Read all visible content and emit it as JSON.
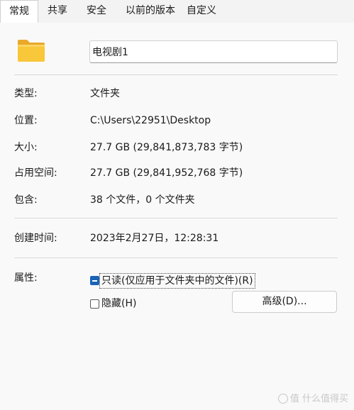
{
  "tabs": [
    {
      "label": "常规",
      "active": true
    },
    {
      "label": "共享",
      "active": false
    },
    {
      "label": "安全",
      "active": false
    },
    {
      "label": "以前的版本",
      "active": false
    },
    {
      "label": "自定义",
      "active": false
    }
  ],
  "folder_icon": "folder-icon",
  "name": "电视剧1",
  "props": {
    "type_label": "类型:",
    "type_value": "文件夹",
    "location_label": "位置:",
    "location_value": "C:\\Users\\22951\\Desktop",
    "size_label": "大小:",
    "size_value": "27.7 GB (29,841,873,783 字节)",
    "disk_label": "占用空间:",
    "disk_value": "27.7 GB (29,841,952,768 字节)",
    "contains_label": "包含:",
    "contains_value": "38 个文件，0 个文件夹",
    "created_label": "创建时间:",
    "created_value": "2023年2月27日，12:28:31"
  },
  "attributes": {
    "label": "属性:",
    "readonly_label": "只读(仅应用于文件夹中的文件)(R)",
    "readonly_checked": "indeterminate",
    "hidden_label": "隐藏(H)",
    "hidden_checked": false,
    "advanced_label": "高级(D)..."
  },
  "watermark": "值 什么值得买",
  "colors": {
    "accent": "#1a63b6",
    "folder_body": "#f8c73a",
    "folder_tab": "#e9a92a"
  }
}
